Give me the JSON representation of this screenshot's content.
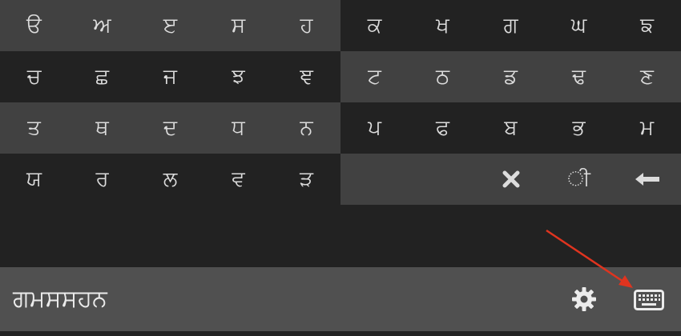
{
  "keyboard": {
    "rows": [
      {
        "left": [
          "ੳ",
          "ਅ",
          "ੲ",
          "ਸ",
          "ਹ"
        ],
        "right": [
          "ਕ",
          "ਖ",
          "ਗ",
          "ਘ",
          "ਙ"
        ]
      },
      {
        "left": [
          "ਚ",
          "ਛ",
          "ਜ",
          "ਝ",
          "ਞ"
        ],
        "right": [
          "ਟ",
          "ਠ",
          "ਡ",
          "ਢ",
          "ਣ"
        ]
      },
      {
        "left": [
          "ਤ",
          "ਥ",
          "ਦ",
          "ਧ",
          "ਨ"
        ],
        "right": [
          "ਪ",
          "ਫ",
          "ਬ",
          "ਭ",
          "ਮ"
        ]
      },
      {
        "left": [
          "ਯ",
          "ਰ",
          "ਲ",
          "ਵ",
          "ੜ"
        ],
        "right_vowel_sign": "ੀ"
      }
    ],
    "icons": {
      "clear": "close-icon",
      "backspace": "arrow-left-icon"
    }
  },
  "input_bar": {
    "text": "ਗਮਸਸਹਨ",
    "icons": [
      "gear-icon",
      "keyboard-icon"
    ]
  },
  "colors": {
    "background": "#222222",
    "key_light": "#414141",
    "bar": "#505050",
    "annotation_arrow": "#e0341f"
  }
}
